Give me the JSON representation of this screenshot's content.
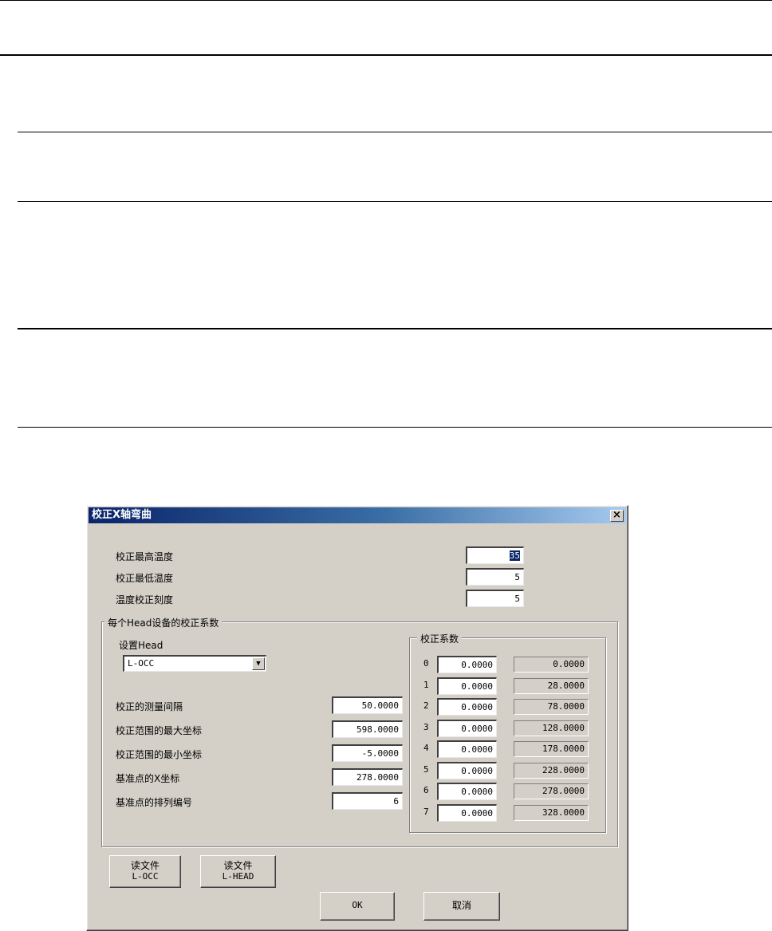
{
  "dialog": {
    "title": "校正X轴弯曲",
    "close_symbol": "×",
    "temp_max_label": "校正最高温度",
    "temp_max_value": "35",
    "temp_min_label": "校正最低温度",
    "temp_min_value": "5",
    "temp_scale_label": "温度校正刻度",
    "temp_scale_value": "5",
    "head_group_title": "每个Head设备的校正系数",
    "head_label": "设置Head",
    "head_selected": "L-OCC",
    "interval_label": "校正的测量间隔",
    "interval_value": "50.0000",
    "range_max_label": "校正范围的最大坐标",
    "range_max_value": "598.0000",
    "range_min_label": "校正范围的最小坐标",
    "range_min_value": "-5.0000",
    "ref_x_label": "基准点的X坐标",
    "ref_x_value": "278.0000",
    "ref_index_label": "基准点的排列编号",
    "ref_index_value": "6",
    "coef_group_title": "校正系数",
    "coefficients": [
      {
        "index": "0",
        "value": "0.0000",
        "position": "0.0000"
      },
      {
        "index": "1",
        "value": "0.0000",
        "position": "28.0000"
      },
      {
        "index": "2",
        "value": "0.0000",
        "position": "78.0000"
      },
      {
        "index": "3",
        "value": "0.0000",
        "position": "128.0000"
      },
      {
        "index": "4",
        "value": "0.0000",
        "position": "178.0000"
      },
      {
        "index": "5",
        "value": "0.0000",
        "position": "228.0000"
      },
      {
        "index": "6",
        "value": "0.0000",
        "position": "278.0000"
      },
      {
        "index": "7",
        "value": "0.0000",
        "position": "328.0000"
      }
    ],
    "read_occ_line1": "读文件",
    "read_occ_line2": "L-OCC",
    "read_head_line1": "读文件",
    "read_head_line2": "L-HEAD",
    "ok_label": "OK",
    "cancel_label": "取消"
  }
}
